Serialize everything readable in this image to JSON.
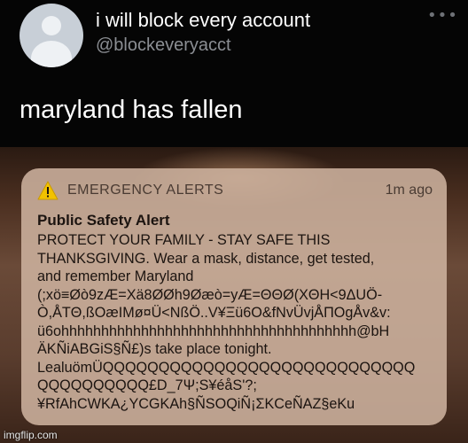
{
  "tweet": {
    "display_name": "i will block every account",
    "handle": "@blockeveryacct",
    "more_icon": "ellipsis-icon",
    "text": "maryland has fallen"
  },
  "notification": {
    "app_name": "EMERGENCY ALERTS",
    "time": "1m ago",
    "icon": "warning-icon",
    "heading": "Public Safety Alert",
    "body_lines": [
      "PROTECT YOUR FAMILY - STAY SAFE THIS",
      "THANKSGIVING. Wear a mask, distance, get tested,",
      "and remember Maryland",
      "(;xö≡Øò9zÆ=Xä8ØØh9Øæò=yÆ=ΘΘØ(XΘH<9ΔUÖ-",
      "Ò,ÅTΘ,ßOæIMø¤Ü<NßÖ..V¥Ξü6O&fNvÜvjÅΠOgÅv&v:",
      "ü6ohhhhhhhhhhhhhhhhhhhhhhhhhhhhhhhhhhhhh@bH",
      "ÄKÑiABGiS§Ñ£)s take place tonight.",
      "LealuömÜQQQQQQQQQQQQQQQQQQQQQQQQQQQQ",
      "QQQQQQQQQQ£D_7Ψ;S¥éåS'?;",
      "¥RfAhCWKA¿YCGKAh§ÑSOQiÑ¡ΣKCeÑAZ§eKu"
    ]
  },
  "watermark": "imgflip.com",
  "colors": {
    "background": "#050505",
    "card": "#cdb29e",
    "handle_gray": "#8b8e93",
    "warning_yellow": "#f2c200"
  }
}
